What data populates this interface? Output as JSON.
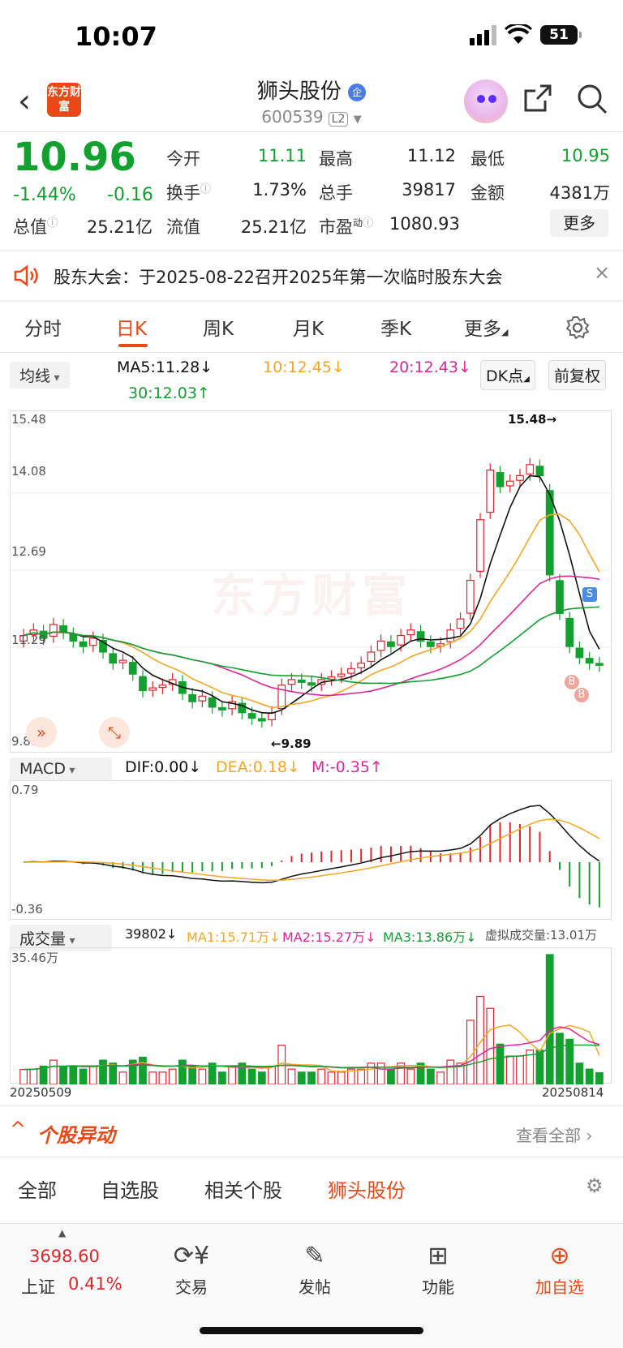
{
  "status_bar": {
    "time": "10:07",
    "battery": "51"
  },
  "header": {
    "logo_text": "东方财富",
    "title": "狮头股份",
    "badge": "企",
    "code": "600539",
    "level": "L2"
  },
  "quote": {
    "price": "10.96",
    "change_pct": "-1.44%",
    "change": "-0.16",
    "items": [
      {
        "label": "今开",
        "value": "11.11",
        "color": "green"
      },
      {
        "label": "最高",
        "value": "11.12",
        "color": "dark"
      },
      {
        "label": "最低",
        "value": "10.95",
        "color": "green"
      },
      {
        "label": "换手",
        "value": "1.73%",
        "color": "dark"
      },
      {
        "label": "总手",
        "value": "39817",
        "color": "dark"
      },
      {
        "label": "金额",
        "value": "4381万",
        "color": "dark"
      },
      {
        "label": "总值",
        "value": "25.21亿",
        "color": "dark"
      },
      {
        "label": "流值",
        "value": "25.21亿",
        "color": "dark"
      },
      {
        "label": "市盈",
        "sup": "动",
        "value": "1080.93",
        "color": "dark"
      }
    ],
    "more_label": "更多"
  },
  "notice": {
    "text": "股东大会：于2025-08-22召开2025年第一次临时股东大会"
  },
  "tabs": [
    "分时",
    "日K",
    "周K",
    "月K",
    "季K",
    "更多"
  ],
  "active_tab": "日K",
  "ma_bar": {
    "selector": "均线",
    "ma5": "MA5:11.28↓",
    "ma10": "10:12.45↓",
    "ma20": "20:12.43↓",
    "ma30": "30:12.03↑",
    "dk_label": "DK点",
    "adjust_label": "前复权"
  },
  "kchart": {
    "y_labels": [
      "15.48",
      "14.08",
      "12.69",
      "11.29",
      "9.89"
    ],
    "high_mark": "15.48",
    "low_mark": "9.89",
    "watermark": "东方财富",
    "signal_s": "S",
    "signal_b": "B"
  },
  "macd": {
    "selector": "MACD",
    "dif": "DIF:0.00↓",
    "dea": "DEA:0.18↓",
    "m": "M:-0.35↑",
    "y_top": "0.79",
    "y_bottom": "-0.36"
  },
  "volume": {
    "selector": "成交量",
    "vol": "39802↓",
    "ma1": "MA1:15.71万↓",
    "ma2": "MA2:15.27万↓",
    "ma3": "MA3:13.86万↓",
    "virtual": "虚拟成交量:13.01万",
    "y_top": "35.46万"
  },
  "dates": {
    "start": "20250509",
    "end": "20250814"
  },
  "movers": {
    "title": "个股异动",
    "view_all": "查看全部",
    "tabs": [
      "全部",
      "自选股",
      "相关个股",
      "狮头股份"
    ],
    "active": "狮头股份"
  },
  "footer": {
    "index_value": "3698.60",
    "index_name": "上证",
    "index_pct": "0.41%",
    "items": [
      {
        "label": "交易",
        "icon": "yen-icon"
      },
      {
        "label": "发帖",
        "icon": "edit-icon"
      },
      {
        "label": "功能",
        "icon": "grid-icon"
      },
      {
        "label": "加自选",
        "icon": "plus-circle-icon"
      }
    ]
  },
  "colors": {
    "up": "#e0252b",
    "down": "#12a02e",
    "accent": "#e84a17",
    "ma10": "#f5a623",
    "ma20": "#e0259a"
  },
  "chart_data": {
    "type": "candlestick",
    "ylim": [
      9.89,
      15.48
    ],
    "close_series_approx": [
      11.5,
      11.6,
      11.45,
      11.7,
      11.55,
      11.4,
      11.3,
      11.45,
      11.2,
      11.0,
      11.05,
      10.8,
      10.5,
      10.55,
      10.6,
      10.7,
      10.45,
      10.3,
      10.4,
      10.2,
      10.15,
      10.3,
      10.1,
      10.0,
      9.95,
      10.1,
      10.6,
      10.7,
      10.65,
      10.6,
      10.7,
      10.75,
      10.8,
      10.9,
      11.0,
      11.2,
      11.4,
      11.3,
      11.5,
      11.6,
      11.4,
      11.3,
      11.35,
      11.6,
      11.8,
      12.5,
      13.6,
      14.5,
      14.2,
      14.3,
      14.4,
      14.6,
      14.4,
      12.6,
      11.9,
      11.3,
      11.1,
      11.0,
      10.96
    ]
  }
}
